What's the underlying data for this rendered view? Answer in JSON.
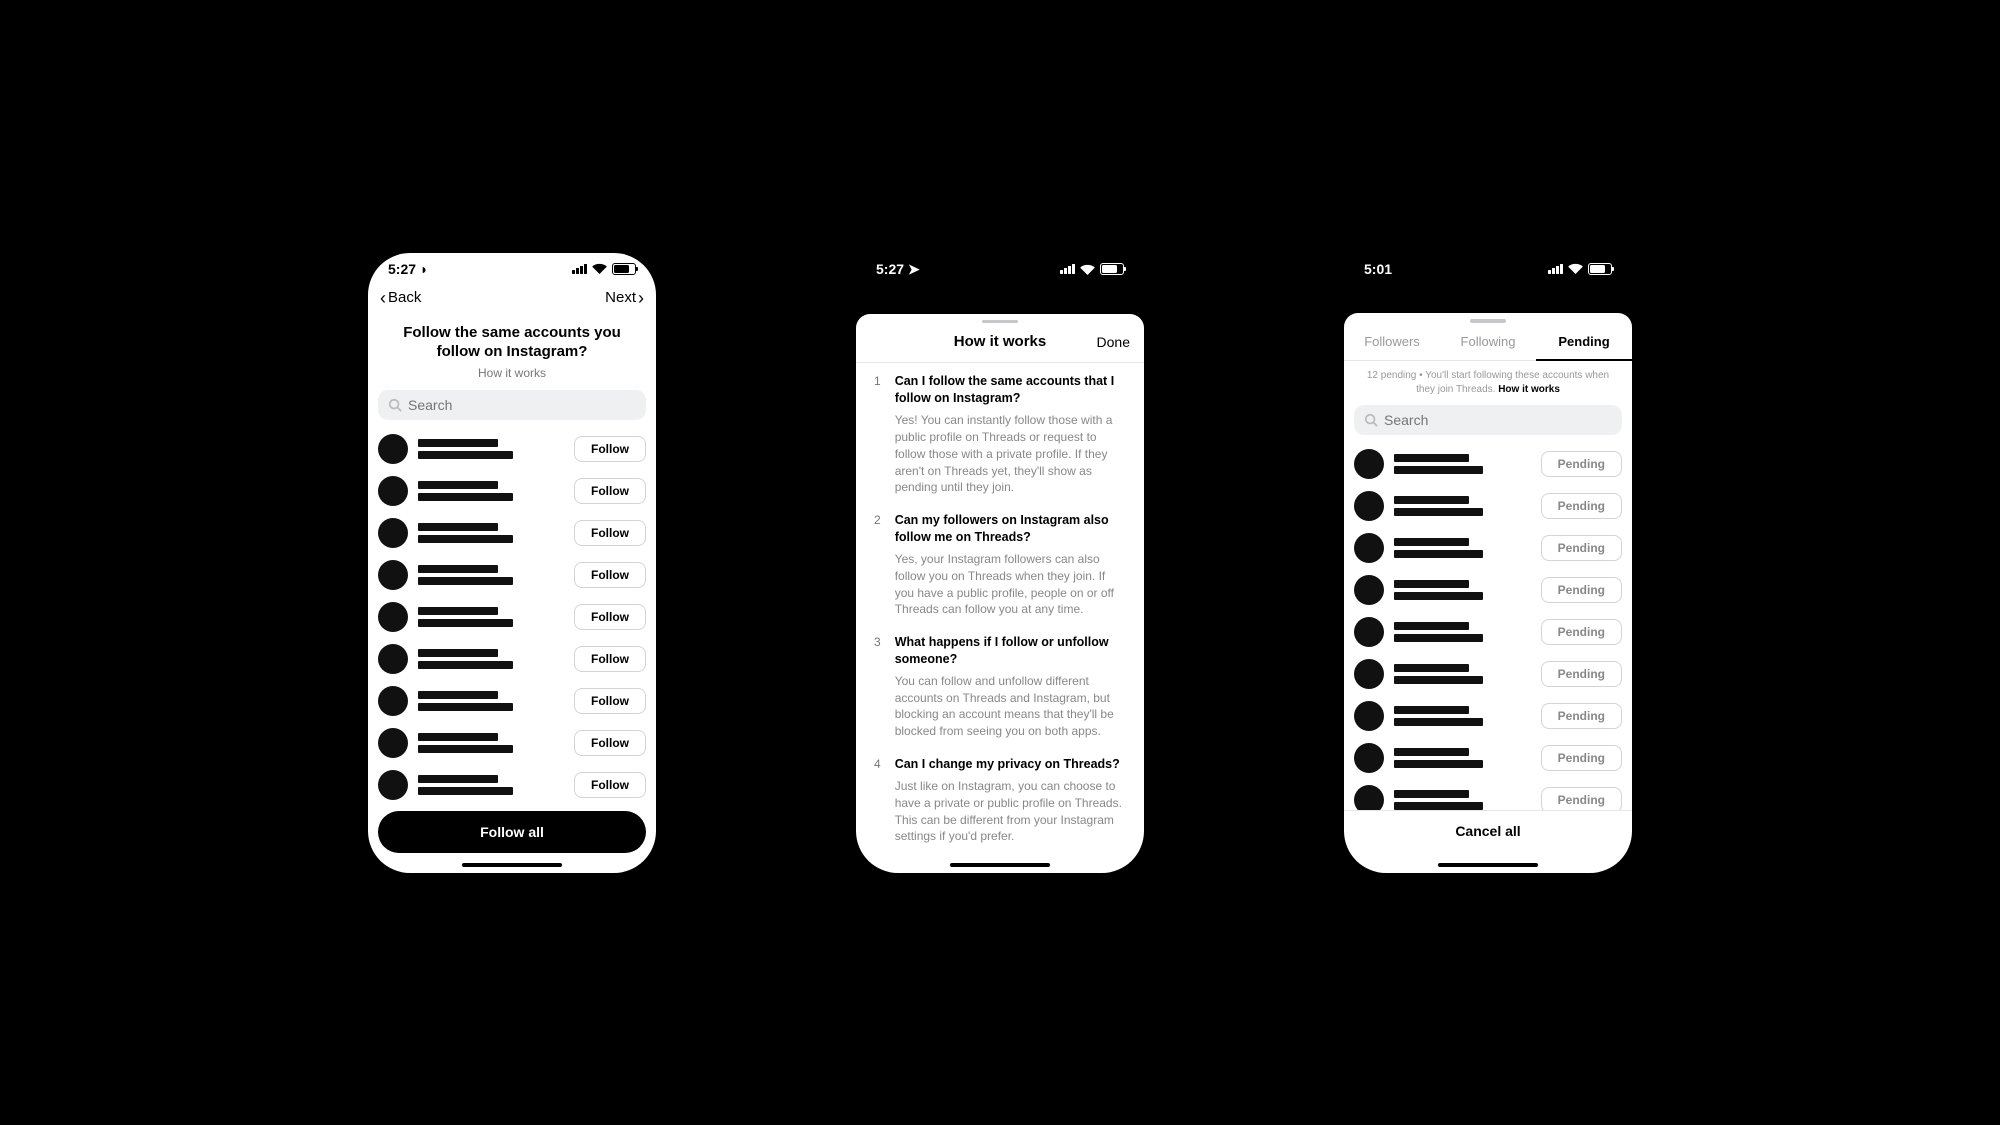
{
  "screen1": {
    "time": "5:27",
    "back": "Back",
    "next": "Next",
    "heading": "Follow the same accounts you follow on Instagram?",
    "sub": "How it works",
    "search_placeholder": "Search",
    "follow_label": "Follow",
    "follow_all": "Follow all",
    "row_count": 9
  },
  "screen2": {
    "time": "5:27",
    "title": "How it works",
    "done": "Done",
    "faq": [
      {
        "q": "Can I follow the same accounts that I follow on Instagram?",
        "a": "Yes! You can instantly follow those with a public profile on Threads or request to follow those with a private profile. If they aren't on Threads yet, they'll show as pending until they join."
      },
      {
        "q": "Can my followers on Instagram also follow me on Threads?",
        "a": "Yes, your Instagram followers can also follow you on Threads when they join. If you have a public profile, people on or off Threads can follow you at any time."
      },
      {
        "q": "What happens if I follow or unfollow someone?",
        "a": "You can follow and unfollow different accounts on Threads and Instagram, but blocking an account means that they'll be blocked from seeing you on both apps."
      },
      {
        "q": "Can I change my privacy on Threads?",
        "a": "Just like on Instagram, you can choose to have a private or public profile on Threads. This can be different from your Instagram settings if you'd prefer."
      }
    ]
  },
  "screen3": {
    "time": "5:01",
    "tabs": {
      "followers": "Followers",
      "following": "Following",
      "pending": "Pending"
    },
    "note_prefix": "12 pending • You'll start following these accounts when they join Threads. ",
    "note_link": "How it works",
    "search_placeholder": "Search",
    "pending_label": "Pending",
    "cancel_all": "Cancel all",
    "row_count": 9
  }
}
